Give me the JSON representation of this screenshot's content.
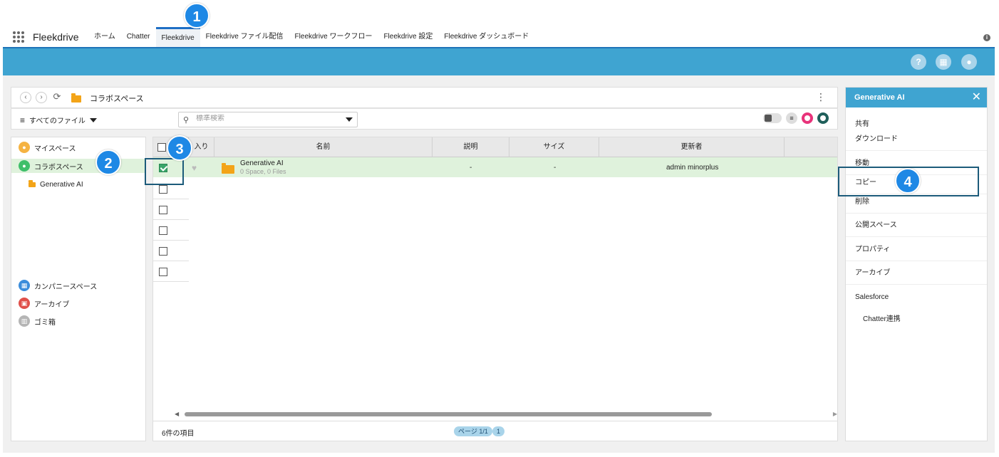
{
  "app": {
    "name": "Fleekdrive"
  },
  "nav": {
    "tabs": [
      {
        "label": "ホーム"
      },
      {
        "label": "Chatter"
      },
      {
        "label": "Fleekdrive",
        "active": true
      },
      {
        "label": "Fleekdrive ファイル配信"
      },
      {
        "label": "Fleekdrive ワークフロー"
      },
      {
        "label": "Fleekdrive 設定"
      },
      {
        "label": "Fleekdrive ダッシュボード"
      }
    ]
  },
  "header_icons": [
    "help-icon",
    "calendar-icon",
    "bell-icon"
  ],
  "breadcrumb": {
    "current": "コラボスペース"
  },
  "filter": {
    "label": "すべてのファイル"
  },
  "search": {
    "placeholder": "標準検索"
  },
  "sidebar": {
    "items": [
      {
        "label": "マイスペース",
        "color": "#f5b342"
      },
      {
        "label": "コラボスペース",
        "color": "#3fbf6a",
        "active": true
      },
      {
        "label": "Generative AI"
      },
      {
        "label": "カンパニースペース",
        "color": "#3b8ddb"
      },
      {
        "label": "アーカイブ",
        "color": "#e0504a"
      },
      {
        "label": "ゴミ箱",
        "color": "#b5b5b5"
      }
    ]
  },
  "grid": {
    "columns": [
      "入り",
      "名前",
      "説明",
      "サイズ",
      "更新者"
    ],
    "rows": [
      {
        "name": "Generative AI",
        "sub": "0 Space, 0 Files",
        "desc": "-",
        "size": "-",
        "updater": "admin minorplus",
        "checked": true
      }
    ],
    "footer_count": "6件の項目",
    "page_label": "ページ 1/1",
    "page_num": "1"
  },
  "right_panel": {
    "title": "Generative AI",
    "items": [
      "共有",
      "ダウンロード",
      "移動",
      "コピー",
      "削除",
      "公開スペース",
      "プロパティ",
      "アーカイブ",
      "Salesforce",
      "Chatter連携"
    ]
  },
  "badges": [
    "1",
    "2",
    "3",
    "4"
  ],
  "colors": {
    "accent": "#3fa4d1",
    "selected_row": "#dff2dc",
    "badge": "#1e88e5"
  }
}
